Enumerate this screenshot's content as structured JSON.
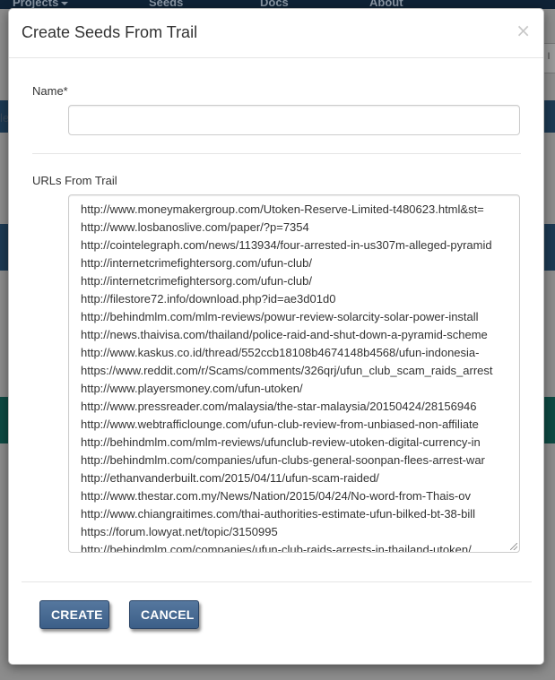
{
  "background": {
    "nav_items": [
      "Projects",
      "Seeds",
      "Docs",
      "About"
    ],
    "right_text": "s I",
    "left_text": "le"
  },
  "modal": {
    "title": "Create Seeds From Trail",
    "close_symbol": "×",
    "name_label": "Name*",
    "name_value": "",
    "urls_label": "URLs From Trail",
    "urls": [
      "http://www.moneymakergroup.com/Utoken-Reserve-Limited-t480623.html&st=",
      "http://www.losbanoslive.com/paper/?p=7354",
      "http://cointelegraph.com/news/113934/four-arrested-in-us307m-alleged-pyramid",
      "http://internetcrimefightersorg.com/ufun-club/",
      "http://internetcrimefightersorg.com/ufun-club/",
      "http://filestore72.info/download.php?id=ae3d01d0",
      "http://behindmlm.com/mlm-reviews/powur-review-solarcity-solar-power-install",
      "http://news.thaivisa.com/thailand/police-raid-and-shut-down-a-pyramid-scheme",
      "http://www.kaskus.co.id/thread/552ccb18108b4674148b4568/ufun-indonesia-",
      "https://www.reddit.com/r/Scams/comments/326qrj/ufun_club_scam_raids_arrest",
      "http://www.playersmoney.com/ufun-utoken/",
      "http://www.pressreader.com/malaysia/the-star-malaysia/20150424/28156946",
      "http://www.webtrafficlounge.com/ufun-club-review-from-unbiased-non-affiliate",
      "http://behindmlm.com/mlm-reviews/ufunclub-review-utoken-digital-currency-in",
      "http://behindmlm.com/companies/ufun-clubs-general-soonpan-flees-arrest-war",
      "http://ethanvanderbuilt.com/2015/04/11/ufun-scam-raided/",
      "http://www.thestar.com.my/News/Nation/2015/04/24/No-word-from-Thais-ov",
      "http://www.chiangraitimes.com/thai-authorities-estimate-ufun-bilked-bt-38-bill",
      "https://forum.lowyat.net/topic/3150995",
      "http://behindmlm.com/companies/ufun-club-raids-arrests-in-thailand-utoken/"
    ],
    "create_label": "CREATE",
    "cancel_label": "CANCEL"
  },
  "colors": {
    "button_bg": "#46698f",
    "overlay": "#8c8c8c"
  }
}
